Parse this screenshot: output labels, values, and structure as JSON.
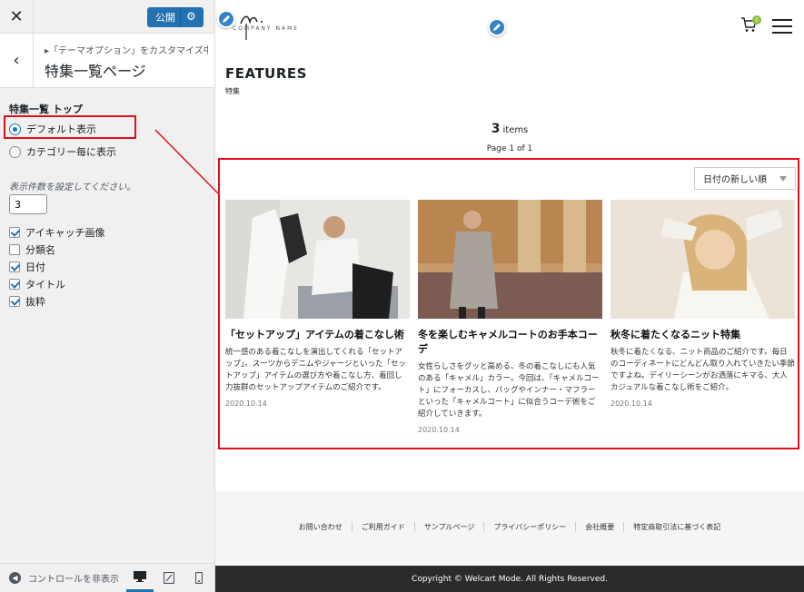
{
  "sidebar": {
    "publish_label": "公開",
    "breadcrumb": "▸「テーマオプション」をカスタマイズ中",
    "section_title": "特集一覧ページ",
    "control_title": "特集一覧 トップ",
    "radio_options": [
      {
        "label": "デフォルト表示",
        "checked": true
      },
      {
        "label": "カテゴリー毎に表示",
        "checked": false
      }
    ],
    "count_label": "表示件数を設定してください。",
    "count_value": "3",
    "checkboxes": [
      {
        "label": "アイキャッチ画像",
        "checked": true
      },
      {
        "label": "分類名",
        "checked": false
      },
      {
        "label": "日付",
        "checked": true
      },
      {
        "label": "タイトル",
        "checked": true
      },
      {
        "label": "抜粋",
        "checked": true
      }
    ],
    "hide_controls_label": "コントロールを非表示"
  },
  "preview": {
    "logo_text": "COMPANY NAME",
    "cart_count": "0",
    "page_title": "FEATURES",
    "page_subtitle": "特集",
    "items_count": "3",
    "items_label": "items",
    "page_indicator": "Page 1 of 1",
    "sort_selected": "日付の新しい順",
    "cards": [
      {
        "title": "「セットアップ」アイテムの着こなし術",
        "excerpt": "統一感のある着こなしを演出してくれる「セットアップ」。スーツからデニムやジャージといった「セットアップ」アイテムの選び方や着こなし方、着回し力抜群のセットアップアイテムのご紹介です。",
        "date": "2020.10.14"
      },
      {
        "title": "冬を楽しむキャメルコートのお手本コーデ",
        "excerpt": "女性らしさをグッと高める、冬の着こなしにも人気のある「キャメル」カラー。今回は、「キャメルコート」にフォーカスし、バッグやインナー・マフラーといった「キャメルコート」に似合うコーデ術をご紹介していきます。",
        "date": "2020.10.14"
      },
      {
        "title": "秋冬に着たくなるニット特集",
        "excerpt": "秋冬に着たくなる、ニット商品のご紹介です。毎日のコーディネートにどんどん取り入れていきたい季節ですよね。デイリーシーンがお洒落にキマる、大人カジュアルな着こなし術をご紹介。",
        "date": "2020.10.14"
      }
    ],
    "footer_links": [
      "お問い合わせ",
      "ご利用ガイド",
      "サンプルページ",
      "プライバシーポリシー",
      "会社概要",
      "特定商取引法に基づく表記"
    ],
    "copyright": "Copyright © Welcart Mode. All Rights Reserved."
  },
  "colors": {
    "accent": "#2271b1",
    "highlight": "#e0101a",
    "badge": "#8bbd3a"
  }
}
